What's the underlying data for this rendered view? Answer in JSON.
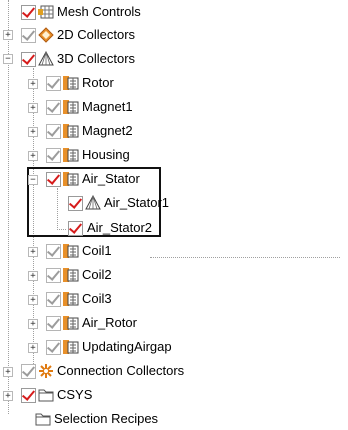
{
  "tree": {
    "mesh_controls": "Mesh Controls",
    "collectors_2d": "2D Collectors",
    "collectors_3d": "3D Collectors",
    "rotor": "Rotor",
    "magnet1": "Magnet1",
    "magnet2": "Magnet2",
    "housing": "Housing",
    "air_stator": "Air_Stator",
    "air_stator1": "Air_Stator1",
    "air_stator2": "Air_Stator2",
    "coil1": "Coil1",
    "coil2": "Coil2",
    "coil3": "Coil3",
    "air_rotor": "Air_Rotor",
    "updating_airgap": "UpdatingAirgap",
    "connection_collectors": "Connection Collectors",
    "csys": "CSYS",
    "selection_recipes": "Selection Recipes"
  },
  "icons": {
    "mesh_controls": "mesh-controls-icon",
    "collectors_2d": "2d-collector-icon",
    "collectors_3d": "3d-collector-icon",
    "mesh_collector": "mesh-collector-icon",
    "connection": "connection-icon",
    "folder": "folder-icon"
  },
  "colors": {
    "check_red": "#d61c1c",
    "check_gray": "#9c9c9c",
    "highlight_border": "#111111"
  }
}
